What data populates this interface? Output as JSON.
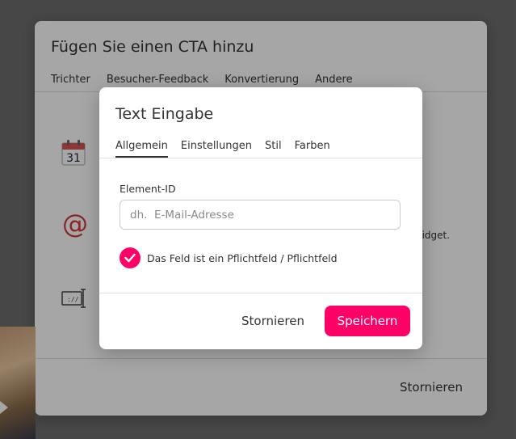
{
  "background_dialog": {
    "title": "Fügen Sie einen CTA hinzu",
    "tabs": [
      "Trichter",
      "Besucher-Feedback",
      "Konvertierung",
      "Andere"
    ],
    "partial_text": "Widget.",
    "cancel_label": "Stornieren",
    "icons": [
      "calendar-icon",
      "at-sign-icon",
      "text-input-icon"
    ]
  },
  "dialog": {
    "title": "Text Eingabe",
    "tabs": [
      {
        "label": "Allgemein",
        "active": true
      },
      {
        "label": "Einstellungen",
        "active": false
      },
      {
        "label": "Stil",
        "active": false
      },
      {
        "label": "Farben",
        "active": false
      }
    ],
    "field_label": "Element-ID",
    "field_placeholder": "dh.  E-Mail-Adresse",
    "field_value": "",
    "required_checked": true,
    "required_label": "Das Feld ist ein Pflichtfeld / Pflichtfeld",
    "cancel_label": "Stornieren",
    "save_label": "Speichern"
  },
  "colors": {
    "accent": "#ff0066",
    "text": "#333333",
    "overlay": "#6e6e6e"
  }
}
